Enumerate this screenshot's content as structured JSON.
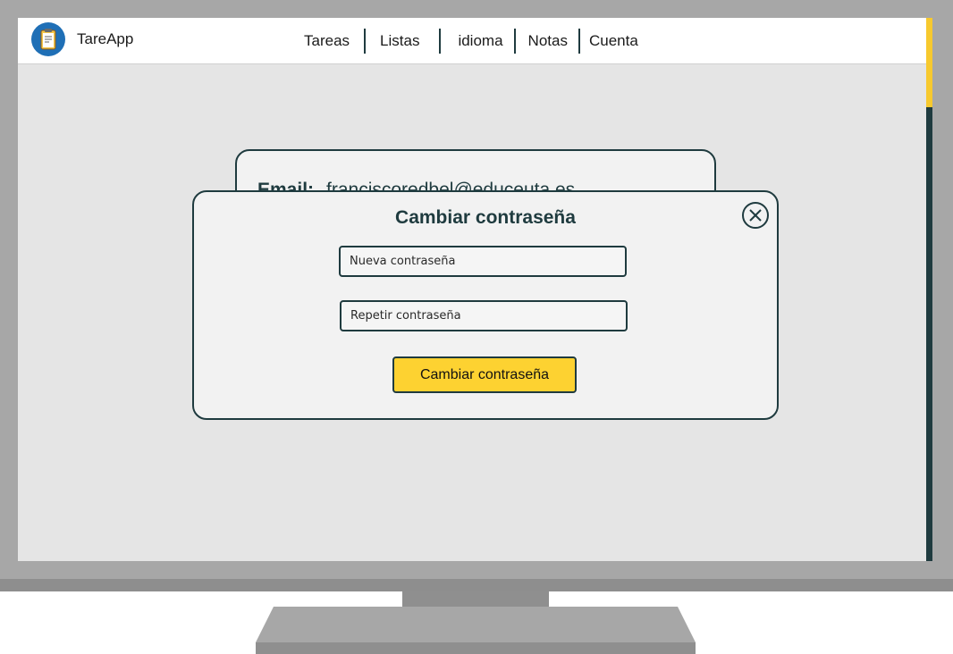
{
  "app": {
    "name": "TareApp",
    "logo_icon": "clipboard-icon"
  },
  "nav": {
    "items": [
      {
        "label": "Tareas"
      },
      {
        "label": "Listas"
      },
      {
        "label": "idioma"
      },
      {
        "label": "Notas"
      },
      {
        "label": "Cuenta"
      }
    ]
  },
  "profile": {
    "email_label": "Email:",
    "email_value": "franciscoredbel@educeuta.es"
  },
  "modal": {
    "title": "Cambiar contraseña",
    "close_icon": "close-circle-icon",
    "new_password_placeholder": "Nueva contraseña",
    "repeat_password_placeholder": "Repetir contraseña",
    "submit_label": "Cambiar contraseña"
  },
  "colors": {
    "accent": "#fdd231",
    "dark": "#1f3b3f",
    "screen_bg": "#e5e5e5",
    "logo_blue": "#1f6fb6"
  }
}
